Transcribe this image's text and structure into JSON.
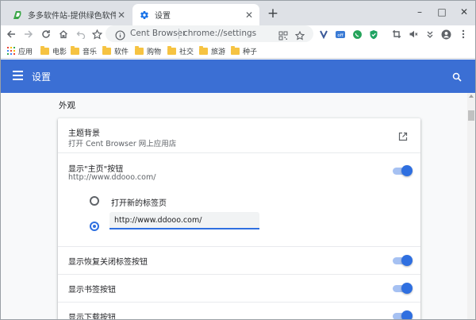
{
  "tabs": [
    {
      "title": "多多软件站-提供绿色软件和热门单机",
      "active": false
    },
    {
      "title": "设置",
      "active": true
    }
  ],
  "new_tab_symbol": "+",
  "window_controls": {
    "minimize": "–",
    "maximize": "□",
    "close": "✕"
  },
  "omnibox": {
    "site_name": "Cent Browser",
    "url": "chrome://settings"
  },
  "toolbar_extensions": [
    {
      "name": "vivaldi-v-icon"
    },
    {
      "name": "off-extension-icon",
      "text": "off"
    },
    {
      "name": "whatsapp-icon"
    },
    {
      "name": "shield-check-icon"
    }
  ],
  "bookmarks": [
    "应用",
    "电影",
    "音乐",
    "软件",
    "购物",
    "社交",
    "旅游",
    "种子"
  ],
  "settings_header": {
    "title": "设置"
  },
  "section": {
    "title": "外观"
  },
  "theme_row": {
    "title": "主题背景",
    "subtitle": "打开 Cent Browser 网上应用店"
  },
  "home_button_row": {
    "title": "显示\"主页\"按钮",
    "subtitle": "http://www.ddooo.com/",
    "enabled": true
  },
  "home_options": {
    "option_new_tab": "打开新的标签页",
    "option_custom_value": "http://www.ddooo.com/",
    "selected": "custom"
  },
  "toggle_rows": [
    {
      "title": "显示恢复关闭标签按钮",
      "enabled": true
    },
    {
      "title": "显示书签按钮",
      "enabled": true
    },
    {
      "title": "显示下载按钮",
      "enabled": true
    }
  ],
  "colors": {
    "header_blue": "#3b6fd4",
    "toggle_on": "#2f6fe0",
    "folder_yellow": "#f6c342"
  }
}
